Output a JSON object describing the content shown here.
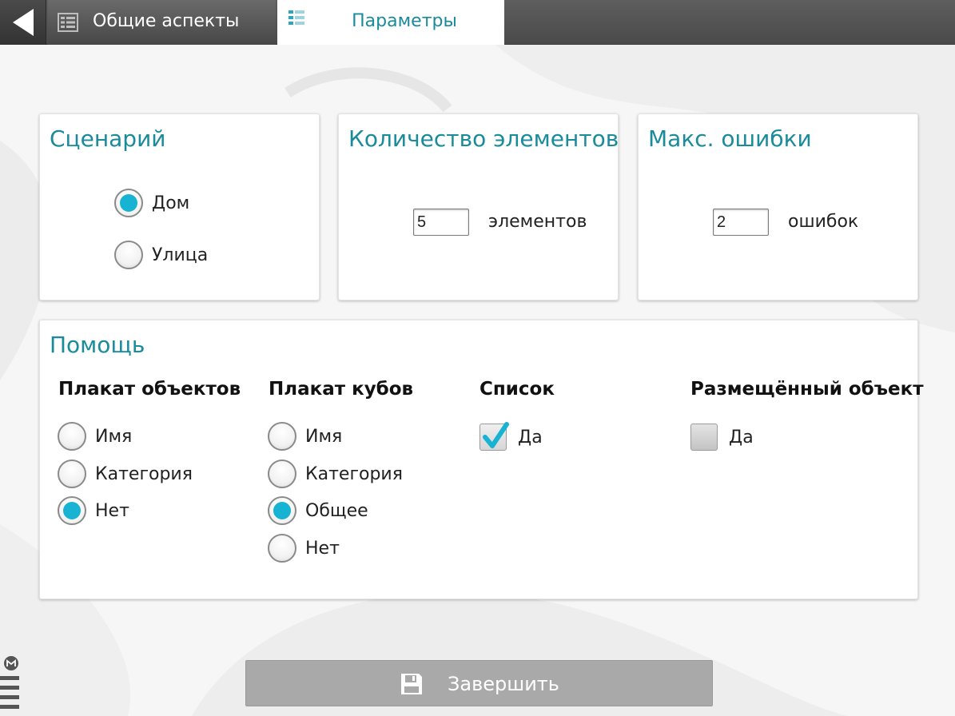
{
  "header": {
    "tab_general": {
      "label": "Общие аспекты",
      "icon": "list-icon"
    },
    "tab_params": {
      "label": "Параметры",
      "icon": "list-icon",
      "active": true
    }
  },
  "scenario": {
    "title": "Сценарий",
    "options": [
      {
        "label": "Дом",
        "checked": true
      },
      {
        "label": "Улица",
        "checked": false
      }
    ]
  },
  "element_count": {
    "title": "Количество элементов",
    "value": "5",
    "unit": "элементов"
  },
  "max_errors": {
    "title": "Макс. ошибки",
    "value": "2",
    "unit": "ошибок"
  },
  "help": {
    "title": "Помощь",
    "object_poster": {
      "heading": "Плакат объектов",
      "options": [
        {
          "label": "Имя",
          "checked": false
        },
        {
          "label": "Категория",
          "checked": false
        },
        {
          "label": "Нет",
          "checked": true
        }
      ]
    },
    "cube_poster": {
      "heading": "Плакат кубов",
      "options": [
        {
          "label": "Имя",
          "checked": false
        },
        {
          "label": "Категория",
          "checked": false
        },
        {
          "label": "Общее",
          "checked": true
        },
        {
          "label": "Нет",
          "checked": false
        }
      ]
    },
    "list": {
      "heading": "Список",
      "label": "Да",
      "checked": true
    },
    "placed_object": {
      "heading": "Размещённый объект",
      "label": "Да",
      "checked": false
    }
  },
  "finish": {
    "label": "Завершить",
    "icon": "save-icon"
  },
  "colors": {
    "accent": "#1a8b9b",
    "radio_fill": "#18b2d2",
    "topbar": "#505050",
    "button": "#a9a9a9"
  }
}
